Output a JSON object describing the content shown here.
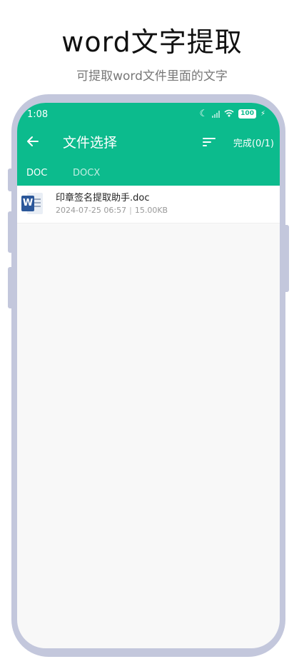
{
  "promo": {
    "title": "word文字提取",
    "subtitle": "可提取word文件里面的文字"
  },
  "status_bar": {
    "time": "1:08",
    "battery": "100"
  },
  "app_bar": {
    "title": "文件选择",
    "done_label": "完成(0/1)",
    "accent_color": "#0cbb8d"
  },
  "tabs": [
    {
      "label": "DOC",
      "selected": true
    },
    {
      "label": "DOCX",
      "selected": false
    }
  ],
  "files": [
    {
      "name": "印章签名提取助手.doc",
      "date": "2024-07-25 06:57",
      "size": "15.00KB",
      "icon": "word-file-icon"
    }
  ]
}
